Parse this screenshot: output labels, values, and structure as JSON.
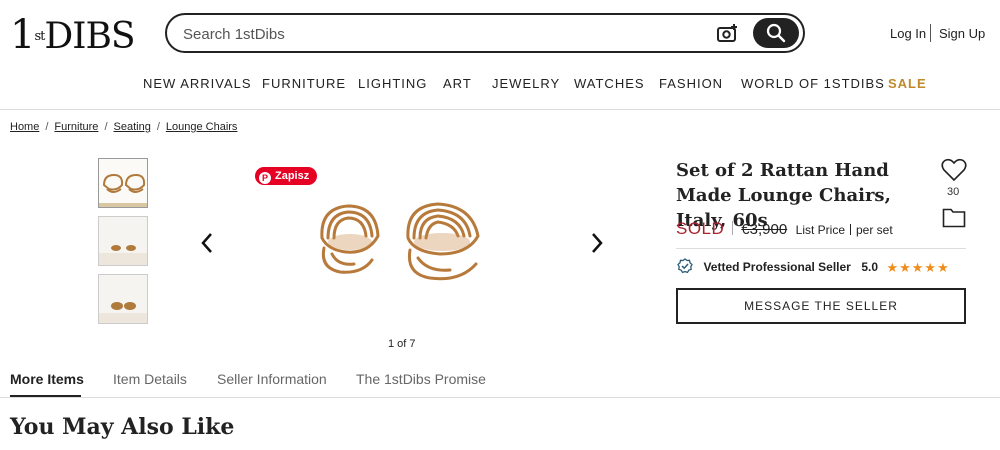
{
  "header": {
    "logo_text": "1stDIBS",
    "logo_num": "1",
    "logo_st": "st",
    "logo_dibs": "DIBS",
    "search_placeholder": "Search 1stDibs",
    "login": "Log In",
    "signup": "Sign Up"
  },
  "nav": [
    {
      "label": "NEW ARRIVALS"
    },
    {
      "label": "FURNITURE"
    },
    {
      "label": "LIGHTING"
    },
    {
      "label": "ART"
    },
    {
      "label": "JEWELRY"
    },
    {
      "label": "WATCHES"
    },
    {
      "label": "FASHION"
    },
    {
      "label": "WORLD OF 1STDIBS"
    },
    {
      "label": "SALE"
    }
  ],
  "breadcrumb": [
    "Home",
    "Furniture",
    "Seating",
    "Lounge Chairs"
  ],
  "gallery": {
    "pinterest_label": "Zapisz",
    "counter": "1 of 7"
  },
  "product": {
    "title": "Set of 2 Rattan Hand Made Lounge Chairs, Italy, 60s",
    "likes": "30",
    "status": "SOLD",
    "old_price": "€3,900",
    "list_price_label": "List Price",
    "per_set": "per set",
    "seller_badge": "Vetted Professional Seller",
    "rating": "5.0",
    "stars": "★★★★★",
    "message_button": "MESSAGE THE SELLER"
  },
  "tabs": [
    {
      "label": "More Items"
    },
    {
      "label": "Item Details"
    },
    {
      "label": "Seller Information"
    },
    {
      "label": "The 1stDibs Promise"
    }
  ],
  "section_title": "You May Also Like",
  "colors": {
    "sold": "#a8232e",
    "sale": "#c08a2a",
    "stars": "#f08c1b",
    "pinterest": "#e60023"
  }
}
